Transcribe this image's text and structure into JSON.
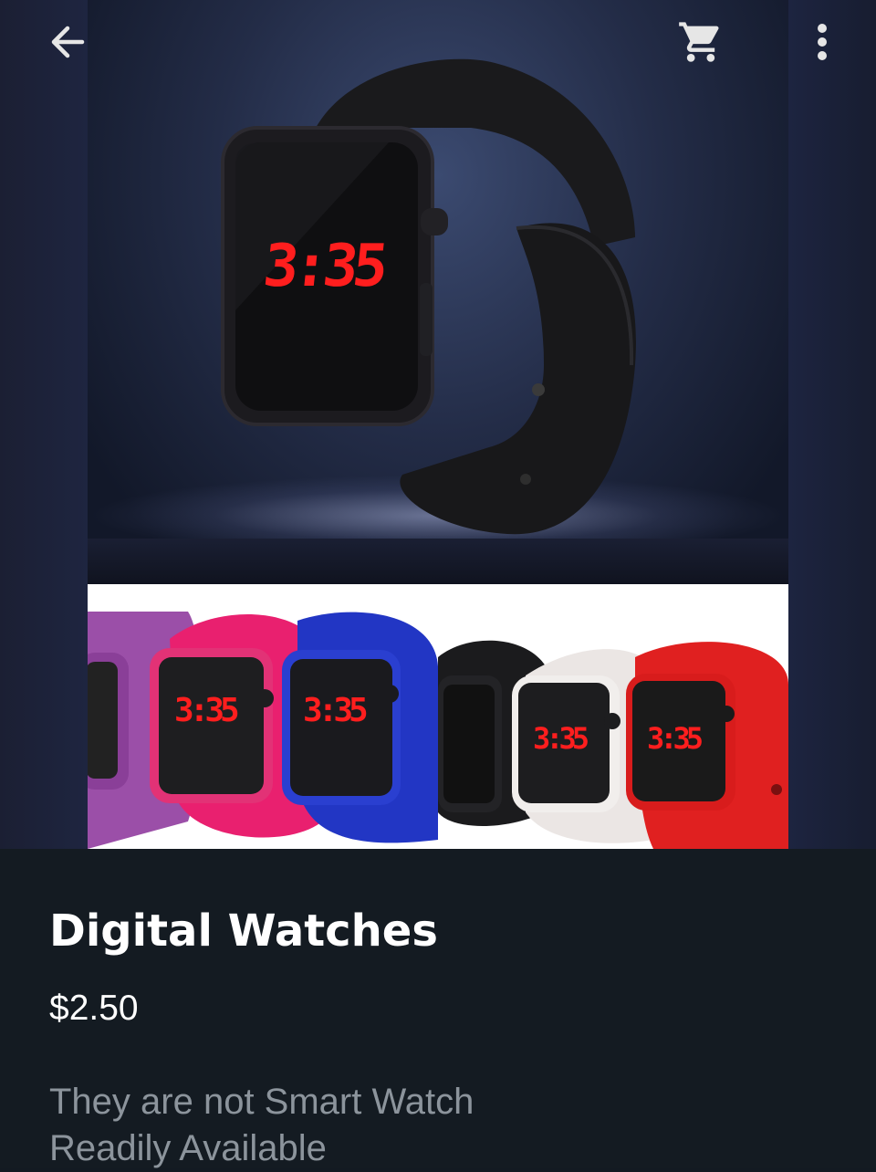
{
  "toolbar": {
    "back_icon": "arrow-left-icon",
    "cart_icon": "shopping-cart-icon",
    "more_icon": "more-vert-icon",
    "icon_color": "#e6e6e6"
  },
  "gallery": {
    "hero_time": "3:35",
    "thumb_time": "3:35",
    "thumb_left_colors": [
      "#9b4fa8",
      "#e9206f",
      "#2236c4"
    ],
    "thumb_right_colors": [
      "#1a1a1a",
      "#ebe6e4",
      "#e02020"
    ],
    "led_color": "#ff1e1e"
  },
  "product": {
    "title": "Digital Watches",
    "price": "$2.50",
    "description_lines": [
      "They are not Smart Watch",
      "Readily Available"
    ]
  },
  "theme": {
    "background": "#131a22",
    "title_color": "#ffffff",
    "description_color": "#8c949c"
  }
}
